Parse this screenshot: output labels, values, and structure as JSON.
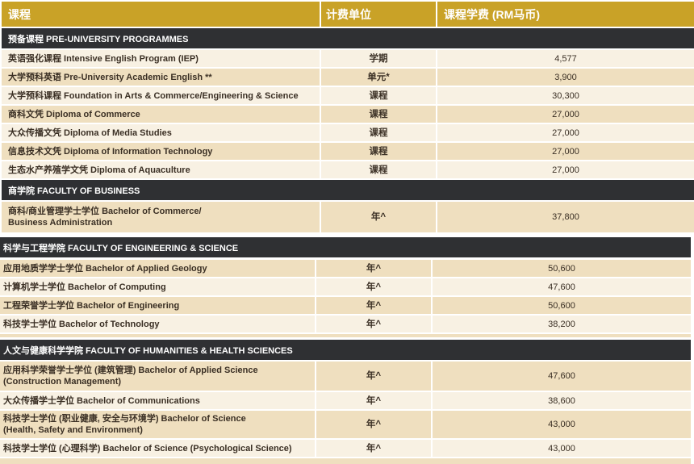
{
  "header": {
    "course": "课程",
    "unit": "计费单位",
    "fee": "课程学费 (RM马币)"
  },
  "sections": [
    {
      "title": "预备课程 PRE-UNIVERSITY PROGRAMMES",
      "rows": [
        {
          "name": "英语强化课程 Intensive English Program (IEP)",
          "unit": "学期",
          "fee": "4,577"
        },
        {
          "name": "大学预科英语 Pre-University Academic English **",
          "unit": "单元*",
          "fee": "3,900"
        },
        {
          "name": "大学预科课程 Foundation in Arts & Commerce/Engineering & Science",
          "unit": "课程",
          "fee": "30,300"
        },
        {
          "name": "商科文凭 Diploma of Commerce",
          "unit": "课程",
          "fee": "27,000"
        },
        {
          "name": "大众传播文凭 Diploma of Media Studies",
          "unit": "课程",
          "fee": "27,000"
        },
        {
          "name": "信息技术文凭 Diploma of Information Technology",
          "unit": "课程",
          "fee": "27,000"
        },
        {
          "name": "生态水产养殖学文凭 Diploma of Aquaculture",
          "unit": "课程",
          "fee": "27,000"
        }
      ]
    },
    {
      "title": "商学院 FACULTY OF BUSINESS",
      "rows": [
        {
          "name_line1": "商科/商业管理学士学位 Bachelor of Commerce/",
          "name_line2": "Business Administration",
          "unit": "年^",
          "fee": "37,800"
        }
      ]
    },
    {
      "title": "科学与工程学院 FACULTY OF ENGINEERING & SCIENCE",
      "rows": [
        {
          "name": "应用地质学学士学位 Bachelor of Applied Geology",
          "unit": "年^",
          "fee": "50,600"
        },
        {
          "name": "计算机学士学位 Bachelor of Computing",
          "unit": "年^",
          "fee": "47,600"
        },
        {
          "name": "工程荣誉学士学位 Bachelor of Engineering",
          "unit": "年^",
          "fee": "50,600"
        },
        {
          "name": "科技学士学位 Bachelor of Technology",
          "unit": "年^",
          "fee": "38,200"
        }
      ]
    },
    {
      "title": "人文与健康科学学院 FACULTY OF HUMANITIES & HEALTH SCIENCES",
      "rows": [
        {
          "name_line1": "应用科学荣誉学士学位 (建筑管理) Bachelor of Applied Science",
          "name_line2": "(Construction Management)",
          "unit": "年^",
          "fee": "47,600"
        },
        {
          "name": "大众传播学士学位 Bachelor of Communications",
          "unit": "年^",
          "fee": "38,600"
        },
        {
          "name_line1": "科技学士学位 (职业健康, 安全与环境学) Bachelor of Science",
          "name_line2": "(Health, Safety and Environment)",
          "unit": "年^",
          "fee": "43,000"
        },
        {
          "name": "科技学士学位 (心理科学) Bachelor of Science (Psychological Science)",
          "unit": "年^",
          "fee": "43,000"
        }
      ]
    }
  ]
}
